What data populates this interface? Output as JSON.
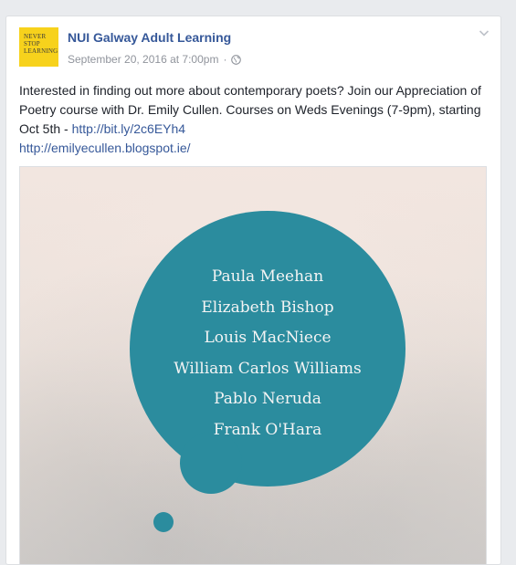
{
  "post": {
    "page_name": "NUI Galway Adult Learning",
    "logo_lines": [
      "NEVER",
      "STOP",
      "LEARNING"
    ],
    "timestamp": "September 20, 2016 at 7:00pm",
    "separator": "·",
    "privacy_icon": "globe-icon",
    "options_icon": "chevron-down-icon",
    "text": "Interested in finding out more about contemporary poets? Join our Appreciation of Poetry course with Dr. Emily Cullen. Courses on Weds Evenings (7-9pm), starting Oct 5th - ",
    "link1": "http://bit.ly/2c6EYh4",
    "link2": "http://emilyecullen.blogspot.ie/"
  },
  "image": {
    "poets": [
      "Paula Meehan",
      "Elizabeth Bishop",
      "Louis MacNiece",
      "William Carlos Williams",
      "Pablo Neruda",
      "Frank O'Hara"
    ]
  },
  "colors": {
    "link": "#365899",
    "bubble": "#2b8c9e",
    "logo_bg": "#f7d21c"
  }
}
